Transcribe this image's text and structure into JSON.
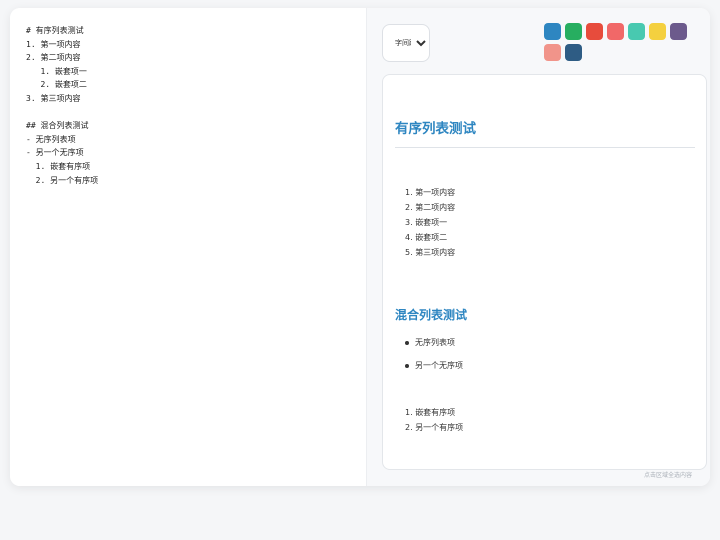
{
  "editor": {
    "lines": [
      "# 有序列表测试",
      "1. 第一项内容",
      "2. 第二项内容",
      "   1. 嵌套项一",
      "   2. 嵌套项二",
      "3. 第三项内容",
      "",
      "## 混合列表测试",
      "- 无序列表项",
      "- 另一个无序项",
      "  1. 嵌套有序项",
      "  2. 另一个有序项"
    ]
  },
  "toolbar": {
    "spacing_selected": "字间距",
    "swatches": [
      "#2e86c1",
      "#27ae60",
      "#e74c3c",
      "#f16868",
      "#48c9b0",
      "#f4d03f",
      "#6c5a8c",
      "#f1948a",
      "#2e5c84"
    ]
  },
  "preview": {
    "h1": "有序列表测试",
    "ordered": [
      "第一项内容",
      "第二项内容",
      "嵌套项一",
      "嵌套项二",
      "第三项内容"
    ],
    "h2": "混合列表测试",
    "unordered": [
      "无序列表项",
      "另一个无序项"
    ],
    "ordered2": [
      "嵌套有序项",
      "另一个有序项"
    ]
  },
  "hint": "点击区域全选内容",
  "colors": {
    "heading": "#2e86c1"
  }
}
